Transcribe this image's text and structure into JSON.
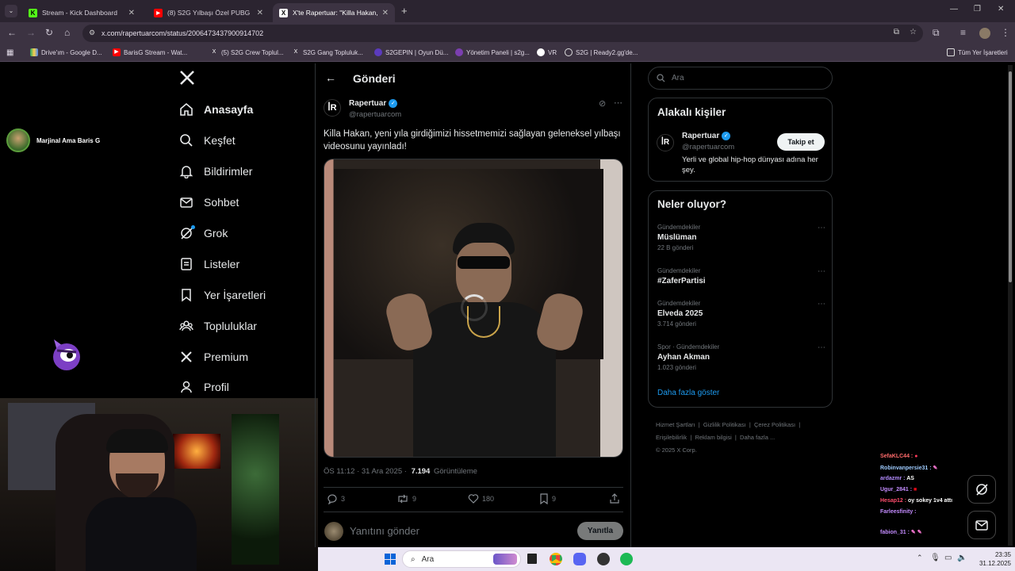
{
  "browser": {
    "tabs": [
      {
        "title": "Stream - Kick Dashboard",
        "icon": "kick-icon",
        "active": false
      },
      {
        "title": "(8) S2G Yılbaşı Özel PUBG Mob",
        "icon": "youtube-icon",
        "active": false
      },
      {
        "title": "X'te Rapertuar: \"Killa Hakan, yeı",
        "icon": "x-icon",
        "active": true
      }
    ],
    "url": "x.com/rapertuarcom/status/2006473437900914702",
    "bookmarks": [
      {
        "label": "Drive'ım - Google D...",
        "icon": "drive-icon"
      },
      {
        "label": "BarisG Stream - Wat...",
        "icon": "youtube-icon"
      },
      {
        "label": "(5) S2G Crew Toplul...",
        "icon": "x-icon"
      },
      {
        "label": "S2G Gang Topluluk...",
        "icon": "x-icon"
      },
      {
        "label": "S2GEPIN | Oyun Dü...",
        "icon": "s2g-icon"
      },
      {
        "label": "Yönetim Paneli | s2g...",
        "icon": "panel-icon"
      },
      {
        "label": "VR",
        "icon": "vr-icon"
      },
      {
        "label": "S2G | Ready2.gg'de...",
        "icon": "globe-icon"
      }
    ],
    "all_bookmarks": "Tüm Yer İşaretleri"
  },
  "stream_overlay": {
    "username": "Marjinal Ama Baris G"
  },
  "sidebar": {
    "items": [
      {
        "label": "Anasayfa",
        "icon": "home-icon"
      },
      {
        "label": "Keşfet",
        "icon": "search-icon"
      },
      {
        "label": "Bildirimler",
        "icon": "bell-icon"
      },
      {
        "label": "Sohbet",
        "icon": "mail-icon"
      },
      {
        "label": "Grok",
        "icon": "grok-icon"
      },
      {
        "label": "Listeler",
        "icon": "list-icon"
      },
      {
        "label": "Yer İşaretleri",
        "icon": "bookmark-icon"
      },
      {
        "label": "Topluluklar",
        "icon": "communities-icon"
      },
      {
        "label": "Premium",
        "icon": "x-icon"
      },
      {
        "label": "Profil",
        "icon": "person-icon"
      }
    ]
  },
  "post": {
    "header": "Gönderi",
    "author_name": "Rapertuar",
    "author_handle": "@rapertuarcom",
    "text": "Killa Hakan, yeni yıla girdiğimizi hissetmemizi sağlayan geleneksel yılbaşı videosunu yayınladı!",
    "time": "ÖS 11:12 · 31 Ara 2025 ·",
    "views_count": "7.194",
    "views_label": "Görüntüleme",
    "replies": "3",
    "reposts": "9",
    "likes": "180",
    "bookmarks": "9",
    "reply_placeholder": "Yanıtını gönder",
    "reply_button": "Yanıtla"
  },
  "right": {
    "search_placeholder": "Ara",
    "related_title": "Alakalı kişiler",
    "related": {
      "name": "Rapertuar",
      "handle": "@rapertuarcom",
      "bio": "Yerli ve global hip-hop dünyası adına her şey.",
      "follow": "Takip et"
    },
    "trends_title": "Neler oluyor?",
    "trends": [
      {
        "category": "Gündemdekiler",
        "name": "Müslüman",
        "count": "22 B gönderi"
      },
      {
        "category": "Gündemdekiler",
        "name": "#ZaferPartisi",
        "count": ""
      },
      {
        "category": "Gündemdekiler",
        "name": "Elveda 2025",
        "count": "3.714 gönderi"
      },
      {
        "category": "Spor · Gündemdekiler",
        "name": "Ayhan Akman",
        "count": "1.023 gönderi"
      }
    ],
    "show_more": "Daha fazla göster",
    "footer_line1": [
      "Hizmet Şartları",
      "Gizlilik Politikası",
      "Çerez Politikası"
    ],
    "footer_line2": [
      "Erişilebilirlik",
      "Reklam bilgisi",
      "Daha fazla ..."
    ],
    "copyright": "© 2025 X Corp."
  },
  "chat": [
    {
      "user": "SefaKLC44 :",
      "msg": "",
      "color": "#ff6b6b"
    },
    {
      "user": "Robinvanpersie31 :",
      "msg": "",
      "color": "#9ecbff"
    },
    {
      "user": "ardazmr :",
      "msg": "AS",
      "color": "#b38cff"
    },
    {
      "user": "Ugur_2841 :",
      "msg": "",
      "color": "#c48cff"
    },
    {
      "user": "Hesap12 :",
      "msg": "oy sokey 1v4 attı",
      "color": "#ff4d6d"
    },
    {
      "user": "Farleesfinity :",
      "msg": "",
      "color": "#c48cff"
    },
    {
      "user": "fabion_31 :",
      "msg": "",
      "color": "#c48cff"
    }
  ],
  "taskbar": {
    "search": "Ara",
    "time": "23:35",
    "date": "31.12.2025"
  }
}
